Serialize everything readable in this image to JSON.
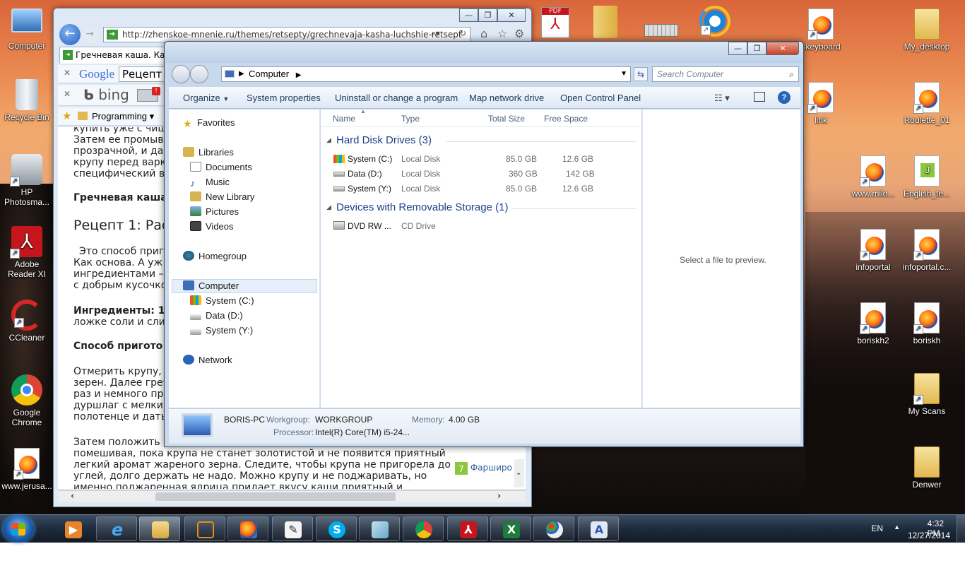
{
  "desktop": {
    "icons_left": [
      {
        "label": "Computer"
      },
      {
        "label": "Recycle Bin"
      },
      {
        "label": "HP Photosma..."
      },
      {
        "label": "Adobe Reader XI"
      },
      {
        "label": "CCleaner"
      },
      {
        "label": "Google Chrome"
      },
      {
        "label": "www.jerusa..."
      }
    ],
    "icons_right": [
      {
        "label": "skeyboard"
      },
      {
        "label": "My_desktop"
      },
      {
        "label": "link"
      },
      {
        "label": "Roulette_01"
      },
      {
        "label": "www.milo..."
      },
      {
        "label": "English_te..."
      },
      {
        "label": "infoportal"
      },
      {
        "label": "infoportal.c..."
      },
      {
        "label": "boriskh2"
      },
      {
        "label": "boriskh"
      },
      {
        "label": "My Scans"
      },
      {
        "label": "Denwer"
      }
    ]
  },
  "browser": {
    "url": "http://zhenskoe-mnenie.ru/themes/retsepty/grechnevaja-kasha-luchshie-retsept",
    "tab_title": "Гречневая каша. Как в...",
    "search_engine_1": "Google",
    "search_value": "Рецепт",
    "search_engine_2": "bing",
    "favorites_folder": "Programming",
    "lines": [
      "купить уже с чищ",
      "Затем ее промыва",
      "прозрачной, и да",
      "крупу перед варк",
      "специфический в",
      "Гречневая каша",
      "Рецепт 1: Рас",
      "Это способ приго",
      "Как основа. А уж",
      "ингредиентами –",
      "с добрым кусочко",
      "Ингредиенты: 1",
      "ложке соли и сли",
      "Способ пригото",
      "Отмерить крупу,",
      "зерен. Далее греч",
      "раз и немного пре",
      "дуршлаг с мелким",
      "полотенце и дать",
      "Затем положить г",
      "помешивая, пока крупа не станет золотистой и не появится приятный",
      "легкий аромат жареного зерна. Следите, чтобы крупа не пригорела до",
      "углей, долго держать не надо. Можно крупу и не поджаривать, но",
      "именно поджаренная ядрица придает вкусу каши приятный и"
    ],
    "side_link": "Фарширо"
  },
  "explorer": {
    "path": "Computer",
    "search_placeholder": "Search Computer",
    "commands": [
      "Organize",
      "System properties",
      "Uninstall or change a program",
      "Map network drive",
      "Open Control Panel"
    ],
    "nav": {
      "favorites": "Favorites",
      "libraries": "Libraries",
      "library_items": [
        "Documents",
        "Music",
        "New Library",
        "Pictures",
        "Videos"
      ],
      "homegroup": "Homegroup",
      "computer": "Computer",
      "computer_items": [
        "System (C:)",
        "Data (D:)",
        "System (Y:)"
      ],
      "network": "Network"
    },
    "columns": [
      "Name",
      "Type",
      "Total Size",
      "Free Space"
    ],
    "group1": "Hard Disk Drives (3)",
    "drives": [
      {
        "name": "System (C:)",
        "type": "Local Disk",
        "total": "85.0 GB",
        "free": "12.6 GB"
      },
      {
        "name": "Data (D:)",
        "type": "Local Disk",
        "total": "360 GB",
        "free": "142 GB"
      },
      {
        "name": "System (Y:)",
        "type": "Local Disk",
        "total": "85.0 GB",
        "free": "12.6 GB"
      }
    ],
    "group2": "Devices with Removable Storage (1)",
    "removable": {
      "name": "DVD RW ...",
      "type": "CD Drive"
    },
    "preview_text": "Select a file to preview.",
    "details": {
      "pc_name": "BORIS-PC",
      "workgroup_label": "Workgroup:",
      "workgroup": "WORKGROUP",
      "memory_label": "Memory:",
      "memory": "4.00 GB",
      "processor_label": "Processor:",
      "processor": "Intel(R) Core(TM) i5-24..."
    }
  },
  "taskbar": {
    "language": "EN",
    "time": "4:32 PM",
    "date": "12/27/2014"
  }
}
